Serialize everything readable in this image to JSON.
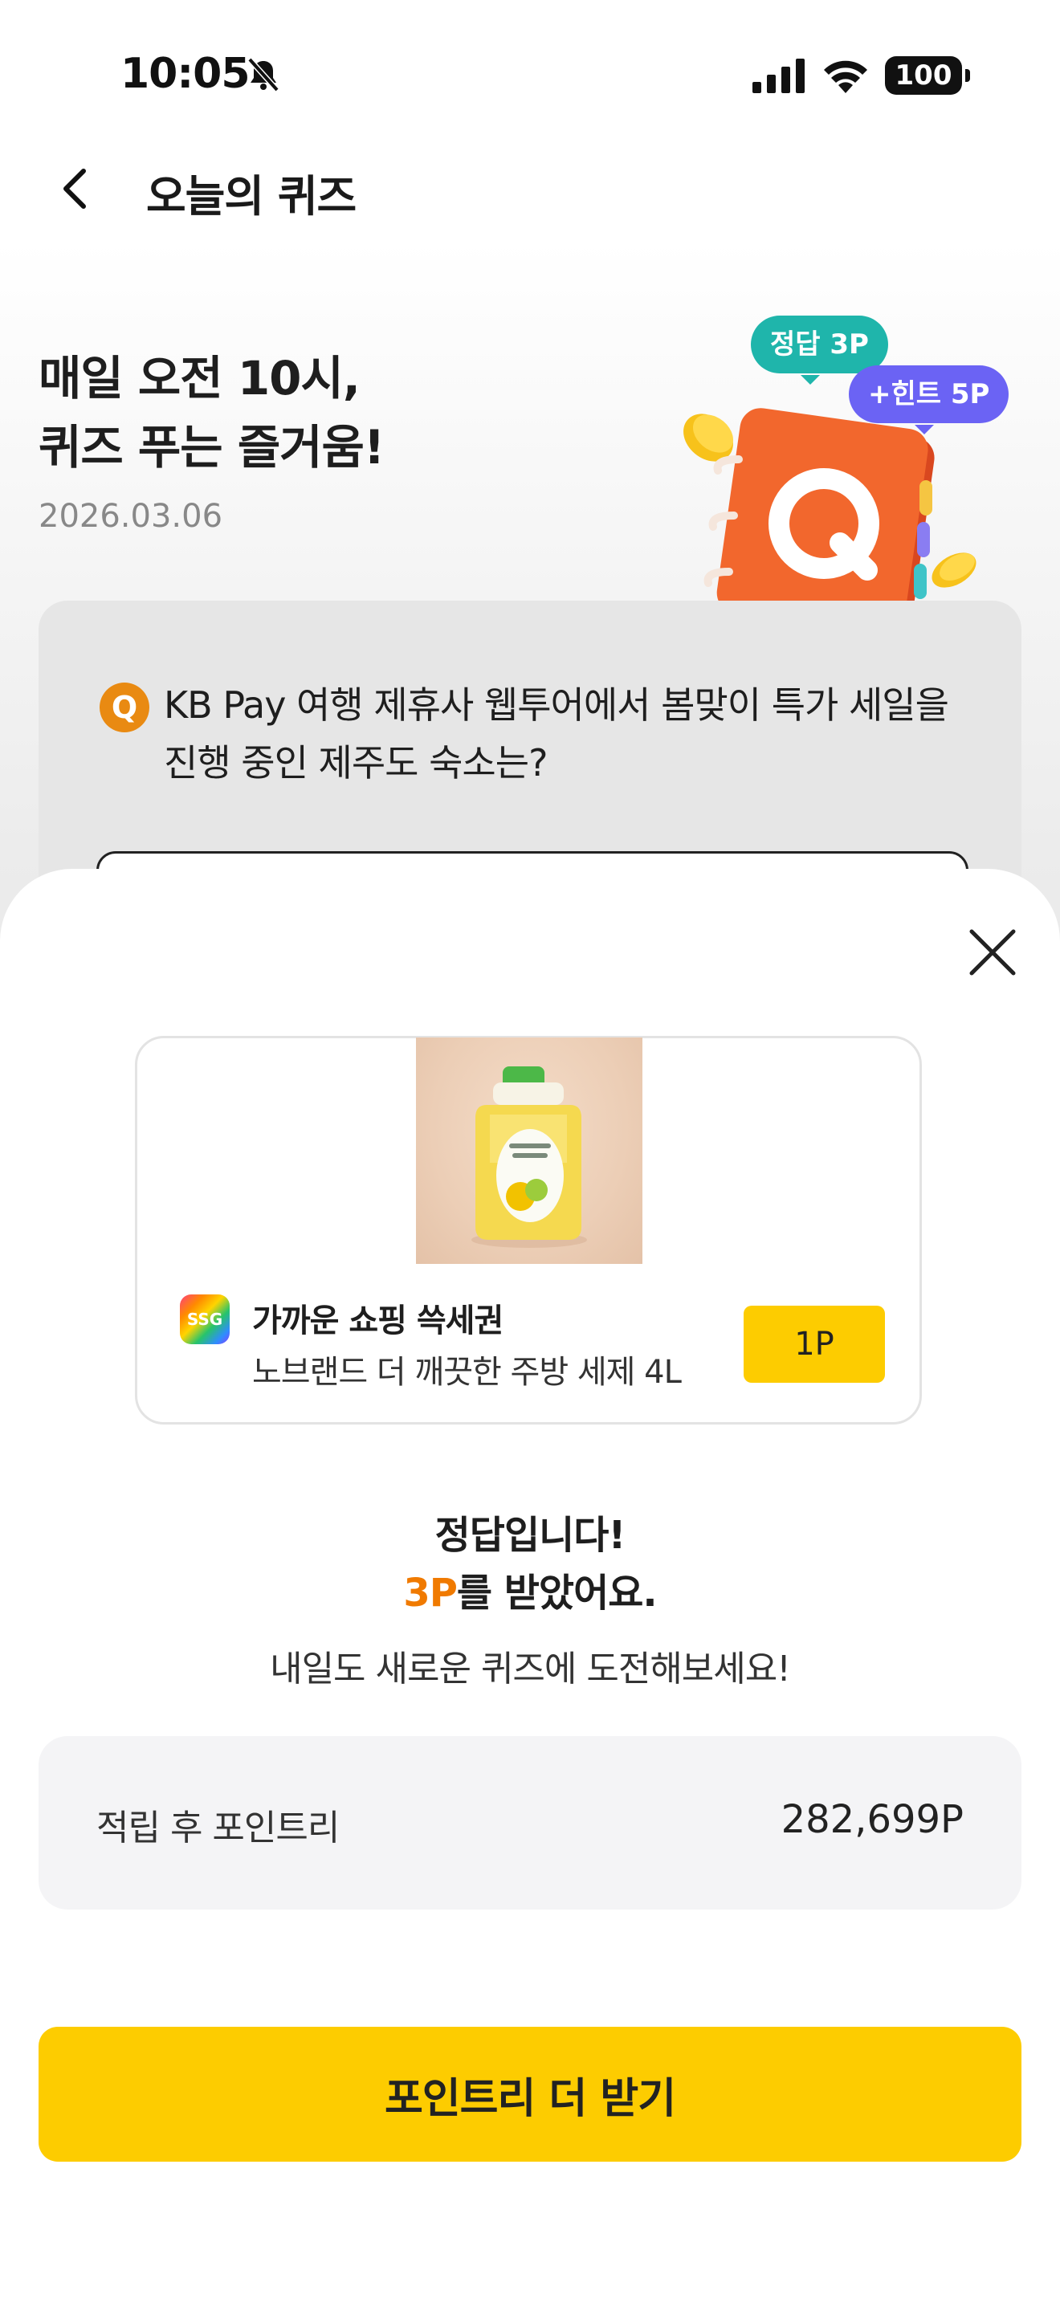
{
  "status_bar": {
    "time": "10:05",
    "battery": "100"
  },
  "header": {
    "title": "오늘의 퀴즈"
  },
  "hero": {
    "title": "매일 오전 10시,\n퀴즈 푸는 즐거움!",
    "date": "2026.03.06",
    "bubble_correct": "정답 3P",
    "bubble_hint": "+힌트 5P",
    "illustration_letter": "Q"
  },
  "quiz": {
    "badge": "Q",
    "question": "KB Pay 여행 제휴사 웹투어에서 봄맞이 특가 세일을 진행 중인 제주도 숙소는?"
  },
  "reward_card": {
    "brand_logo_text": "SSG",
    "brand": "가까운 쇼핑 쓱세권",
    "product": "노브랜드 더 깨끗한 주방 세제 4L",
    "price": "1P"
  },
  "result": {
    "line1": "정답입니다!",
    "points_earned": "3P",
    "line2_suffix": "를 받았어요.",
    "sub": "내일도 새로운 퀴즈에 도전해보세요!"
  },
  "points": {
    "label": "적립 후 포인트리",
    "value": "282,699P"
  },
  "cta": {
    "label": "포인트리 더 받기"
  },
  "colors": {
    "accent_yellow": "#fdcc00",
    "points_orange": "#f07a00",
    "bubble_green": "#1fb5ab",
    "bubble_purple": "#6b63f4",
    "quiz_orange": "#e98a12"
  },
  "icons": {
    "back": "chevron-left-icon",
    "close": "close-icon",
    "bell": "bell-slash-icon",
    "signal": "signal-icon",
    "wifi": "wifi-icon"
  }
}
